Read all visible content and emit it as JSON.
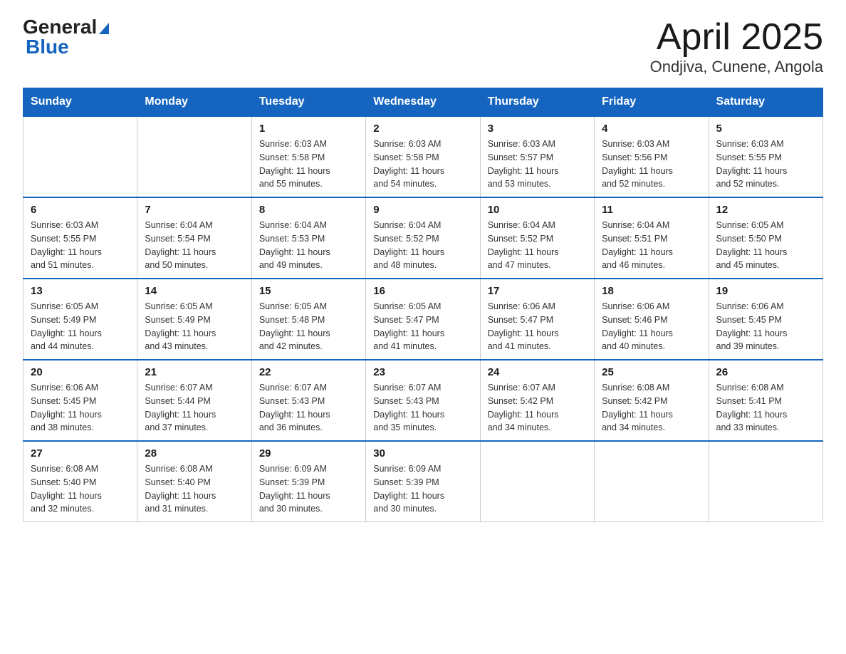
{
  "logo": {
    "general": "General",
    "blue": "Blue"
  },
  "header": {
    "month": "April 2025",
    "location": "Ondjiva, Cunene, Angola"
  },
  "days_of_week": [
    "Sunday",
    "Monday",
    "Tuesday",
    "Wednesday",
    "Thursday",
    "Friday",
    "Saturday"
  ],
  "weeks": [
    [
      {
        "day": "",
        "info": ""
      },
      {
        "day": "",
        "info": ""
      },
      {
        "day": "1",
        "info": "Sunrise: 6:03 AM\nSunset: 5:58 PM\nDaylight: 11 hours\nand 55 minutes."
      },
      {
        "day": "2",
        "info": "Sunrise: 6:03 AM\nSunset: 5:58 PM\nDaylight: 11 hours\nand 54 minutes."
      },
      {
        "day": "3",
        "info": "Sunrise: 6:03 AM\nSunset: 5:57 PM\nDaylight: 11 hours\nand 53 minutes."
      },
      {
        "day": "4",
        "info": "Sunrise: 6:03 AM\nSunset: 5:56 PM\nDaylight: 11 hours\nand 52 minutes."
      },
      {
        "day": "5",
        "info": "Sunrise: 6:03 AM\nSunset: 5:55 PM\nDaylight: 11 hours\nand 52 minutes."
      }
    ],
    [
      {
        "day": "6",
        "info": "Sunrise: 6:03 AM\nSunset: 5:55 PM\nDaylight: 11 hours\nand 51 minutes."
      },
      {
        "day": "7",
        "info": "Sunrise: 6:04 AM\nSunset: 5:54 PM\nDaylight: 11 hours\nand 50 minutes."
      },
      {
        "day": "8",
        "info": "Sunrise: 6:04 AM\nSunset: 5:53 PM\nDaylight: 11 hours\nand 49 minutes."
      },
      {
        "day": "9",
        "info": "Sunrise: 6:04 AM\nSunset: 5:52 PM\nDaylight: 11 hours\nand 48 minutes."
      },
      {
        "day": "10",
        "info": "Sunrise: 6:04 AM\nSunset: 5:52 PM\nDaylight: 11 hours\nand 47 minutes."
      },
      {
        "day": "11",
        "info": "Sunrise: 6:04 AM\nSunset: 5:51 PM\nDaylight: 11 hours\nand 46 minutes."
      },
      {
        "day": "12",
        "info": "Sunrise: 6:05 AM\nSunset: 5:50 PM\nDaylight: 11 hours\nand 45 minutes."
      }
    ],
    [
      {
        "day": "13",
        "info": "Sunrise: 6:05 AM\nSunset: 5:49 PM\nDaylight: 11 hours\nand 44 minutes."
      },
      {
        "day": "14",
        "info": "Sunrise: 6:05 AM\nSunset: 5:49 PM\nDaylight: 11 hours\nand 43 minutes."
      },
      {
        "day": "15",
        "info": "Sunrise: 6:05 AM\nSunset: 5:48 PM\nDaylight: 11 hours\nand 42 minutes."
      },
      {
        "day": "16",
        "info": "Sunrise: 6:05 AM\nSunset: 5:47 PM\nDaylight: 11 hours\nand 41 minutes."
      },
      {
        "day": "17",
        "info": "Sunrise: 6:06 AM\nSunset: 5:47 PM\nDaylight: 11 hours\nand 41 minutes."
      },
      {
        "day": "18",
        "info": "Sunrise: 6:06 AM\nSunset: 5:46 PM\nDaylight: 11 hours\nand 40 minutes."
      },
      {
        "day": "19",
        "info": "Sunrise: 6:06 AM\nSunset: 5:45 PM\nDaylight: 11 hours\nand 39 minutes."
      }
    ],
    [
      {
        "day": "20",
        "info": "Sunrise: 6:06 AM\nSunset: 5:45 PM\nDaylight: 11 hours\nand 38 minutes."
      },
      {
        "day": "21",
        "info": "Sunrise: 6:07 AM\nSunset: 5:44 PM\nDaylight: 11 hours\nand 37 minutes."
      },
      {
        "day": "22",
        "info": "Sunrise: 6:07 AM\nSunset: 5:43 PM\nDaylight: 11 hours\nand 36 minutes."
      },
      {
        "day": "23",
        "info": "Sunrise: 6:07 AM\nSunset: 5:43 PM\nDaylight: 11 hours\nand 35 minutes."
      },
      {
        "day": "24",
        "info": "Sunrise: 6:07 AM\nSunset: 5:42 PM\nDaylight: 11 hours\nand 34 minutes."
      },
      {
        "day": "25",
        "info": "Sunrise: 6:08 AM\nSunset: 5:42 PM\nDaylight: 11 hours\nand 34 minutes."
      },
      {
        "day": "26",
        "info": "Sunrise: 6:08 AM\nSunset: 5:41 PM\nDaylight: 11 hours\nand 33 minutes."
      }
    ],
    [
      {
        "day": "27",
        "info": "Sunrise: 6:08 AM\nSunset: 5:40 PM\nDaylight: 11 hours\nand 32 minutes."
      },
      {
        "day": "28",
        "info": "Sunrise: 6:08 AM\nSunset: 5:40 PM\nDaylight: 11 hours\nand 31 minutes."
      },
      {
        "day": "29",
        "info": "Sunrise: 6:09 AM\nSunset: 5:39 PM\nDaylight: 11 hours\nand 30 minutes."
      },
      {
        "day": "30",
        "info": "Sunrise: 6:09 AM\nSunset: 5:39 PM\nDaylight: 11 hours\nand 30 minutes."
      },
      {
        "day": "",
        "info": ""
      },
      {
        "day": "",
        "info": ""
      },
      {
        "day": "",
        "info": ""
      }
    ]
  ]
}
